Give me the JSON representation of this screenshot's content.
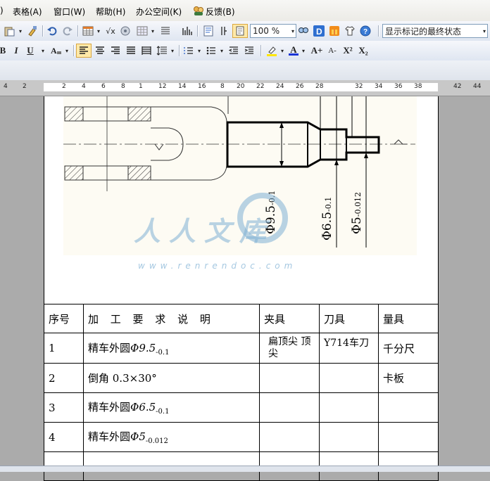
{
  "menu": {
    "paren": ")",
    "items": [
      "表格(A)",
      "窗口(W)",
      "帮助(H)",
      "办公空间(K)",
      "反馈(B)"
    ]
  },
  "toolbar": {
    "zoom": "100 %",
    "markup_view": "显示标记的最终状态"
  },
  "format_toolbar": {
    "bold": "B",
    "italic": "I",
    "underline": "U",
    "font_color_letter": "A",
    "grow_font": "A+",
    "shrink_font": "A-",
    "superscript": "X²",
    "subscript": "X₂"
  },
  "ruler": {
    "ticks": [
      "4",
      "2",
      "2",
      "4",
      "6",
      "8",
      "1",
      "12",
      "14",
      "16",
      "8",
      "20",
      "22",
      "24",
      "26",
      "28",
      "32",
      "34",
      "36",
      "38",
      "42",
      "44"
    ]
  },
  "figure": {
    "dim1": "Φ9.5",
    "dim1_tol": "-0.1",
    "dim2": "Φ6.5",
    "dim2_tol": "-0.1",
    "dim3": "Φ5",
    "dim3_tol": "-0.012"
  },
  "watermark": {
    "text": "人人文库",
    "url": "www.renrendoc.com"
  },
  "table": {
    "headers": [
      "序号",
      "加 工 要 求 说 明",
      "夹具",
      "刀具",
      "量具"
    ],
    "rows": [
      {
        "no": "1",
        "desc": "精车外圆",
        "sym": "Φ9.5",
        "tol": "-0.1",
        "fixture": "扁顶尖 顶尖",
        "tool": "Y714车刀",
        "gauge": "千分尺"
      },
      {
        "no": "2",
        "desc": "倒角 0.3×30°",
        "sym": "",
        "tol": "",
        "fixture": "",
        "tool": "",
        "gauge": "卡板"
      },
      {
        "no": "3",
        "desc": "精车外圆",
        "sym": "Φ6.5",
        "tol": "-0.1",
        "fixture": "",
        "tool": "",
        "gauge": ""
      },
      {
        "no": "4",
        "desc": "精车外圆",
        "sym": "Φ5",
        "tol": "-0.012",
        "fixture": "",
        "tool": "",
        "gauge": ""
      },
      {
        "no": "",
        "desc": "",
        "sym": "",
        "tol": "",
        "fixture": "",
        "tool": "",
        "gauge": ""
      }
    ]
  },
  "colors": {
    "accent": "#3a6fcf",
    "watermark": "#7fb0d4"
  }
}
